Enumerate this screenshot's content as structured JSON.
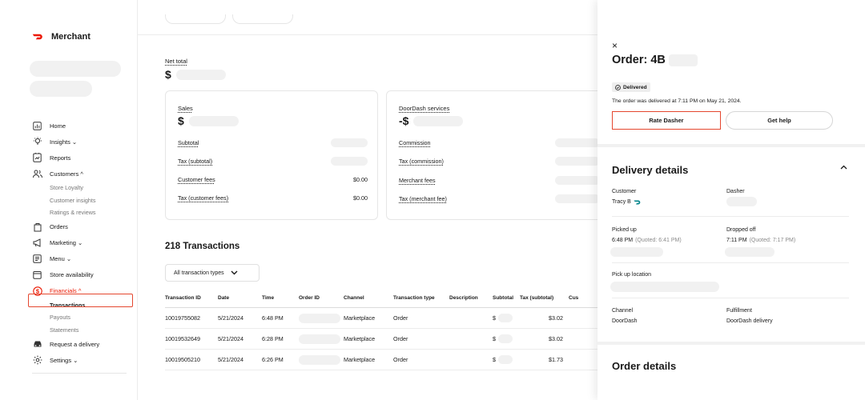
{
  "brand": {
    "name": "Merchant",
    "color": "#eb1700"
  },
  "nav": {
    "home": "Home",
    "insights": "Insights ⌄",
    "reports": "Reports",
    "customers": "Customers ^",
    "customers_sub": [
      "Store Loyalty",
      "Customer insights",
      "Ratings & reviews"
    ],
    "orders": "Orders",
    "marketing": "Marketing ⌄",
    "menu": "Menu ⌄",
    "store_availability": "Store availability",
    "financials": "Financials ^",
    "financials_sub": [
      "Transactions",
      "Payouts",
      "Statements"
    ],
    "request_delivery": "Request a delivery",
    "settings": "Settings ⌄"
  },
  "summary": {
    "net_total_label": "Net total",
    "currency": "$",
    "sales": {
      "title": "Sales",
      "big_prefix": "$",
      "rows": [
        {
          "label": "Subtotal",
          "value": ""
        },
        {
          "label": "Tax (subtotal)",
          "value": ""
        },
        {
          "label": "Customer fees",
          "value": "$0.00"
        },
        {
          "label": "Tax (customer fees)",
          "value": "$0.00"
        }
      ]
    },
    "services": {
      "title": "DoorDash services",
      "big_prefix": "-$",
      "rows": [
        {
          "label": "Commission",
          "value": ""
        },
        {
          "label": "Tax (commission)",
          "value": ""
        },
        {
          "label": "Merchant fees",
          "value": ""
        },
        {
          "label": "Tax (merchant fee)",
          "value": ""
        }
      ]
    }
  },
  "transactions": {
    "title": "218 Transactions",
    "filter_label": "All transaction types",
    "columns": [
      "Transaction ID",
      "Date",
      "Time",
      "Order ID",
      "Channel",
      "Transaction type",
      "Description",
      "Subtotal",
      "Tax (subtotal)",
      "Cus"
    ],
    "rows": [
      {
        "id": "10019755082",
        "date": "5/21/2024",
        "time": "6:48 PM",
        "channel": "Marketplace",
        "type": "Order",
        "subtotal": "$",
        "tax": "$3.02"
      },
      {
        "id": "10019532649",
        "date": "5/21/2024",
        "time": "6:28 PM",
        "channel": "Marketplace",
        "type": "Order",
        "subtotal": "$",
        "tax": "$3.02"
      },
      {
        "id": "10019505210",
        "date": "5/21/2024",
        "time": "6:26 PM",
        "channel": "Marketplace",
        "type": "Order",
        "subtotal": "$",
        "tax": "$1.73"
      }
    ]
  },
  "order": {
    "close_glyph": "×",
    "title": "Order: 4B",
    "status": "Delivered",
    "delivered_msg": "The order was delivered at 7:11 PM on May 21, 2024.",
    "rate_dasher": "Rate Dasher",
    "get_help": "Get help",
    "delivery_details_title": "Delivery details",
    "customer_label": "Customer",
    "customer_value": "Tracy B",
    "dasher_label": "Dasher",
    "picked_up_label": "Picked up",
    "picked_up_time": "6:48 PM",
    "picked_up_quoted": "(Quoted: 6:41 PM)",
    "dropped_off_label": "Dropped off",
    "dropped_off_time": "7:11 PM",
    "dropped_off_quoted": "(Quoted: 7:17 PM)",
    "pickup_location_label": "Pick up location",
    "channel_label": "Channel",
    "channel_value": "DoorDash",
    "fulfillment_label": "Fulfillment",
    "fulfillment_value": "DoorDash delivery",
    "order_details_title": "Order details"
  },
  "colors": {
    "accent": "#eb1700",
    "highlight": "#e4472f",
    "dashpass": "#00838a"
  }
}
